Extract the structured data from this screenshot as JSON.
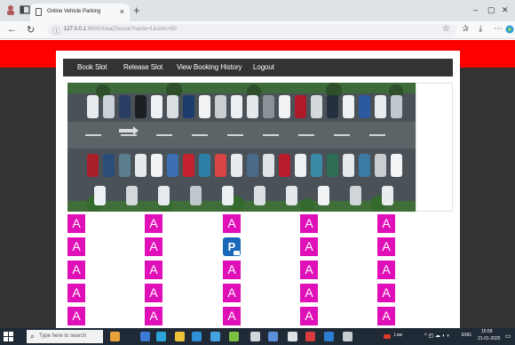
{
  "browser": {
    "tab_title": "Online Vehicle Parking",
    "url_host": "127.0.0.1",
    "url_rest": ":8000/AreaChoose?name=1&slots=50",
    "new_tab": "+",
    "tab_close": "×",
    "window_controls": [
      "–",
      "▢",
      "✕"
    ]
  },
  "nav": {
    "book_slot": "Book Slot",
    "release_slot": "Release Slot",
    "view_history": "View Booking History",
    "logout": "Logout"
  },
  "slots": {
    "available_label": "A",
    "parked_label": "P",
    "columns": 5,
    "visible_rows": 5,
    "grid": [
      [
        "A",
        "A",
        "A",
        "A",
        "A"
      ],
      [
        "A",
        "A",
        "P",
        "A",
        "A"
      ],
      [
        "A",
        "A",
        "A",
        "A",
        "A"
      ],
      [
        "A",
        "A",
        "A",
        "A",
        "A"
      ],
      [
        "A",
        "A",
        "A",
        "A",
        "A"
      ]
    ]
  },
  "taskbar": {
    "search_placeholder": "Type here to search",
    "weather": "Low",
    "time": "15:58",
    "date": "21-01-2025",
    "lang": "ENG"
  },
  "colors": {
    "red_band": "#ff0000",
    "dark_bg": "#333333",
    "slot_available": "#e010b9",
    "slot_parked": "#1a68b7"
  }
}
